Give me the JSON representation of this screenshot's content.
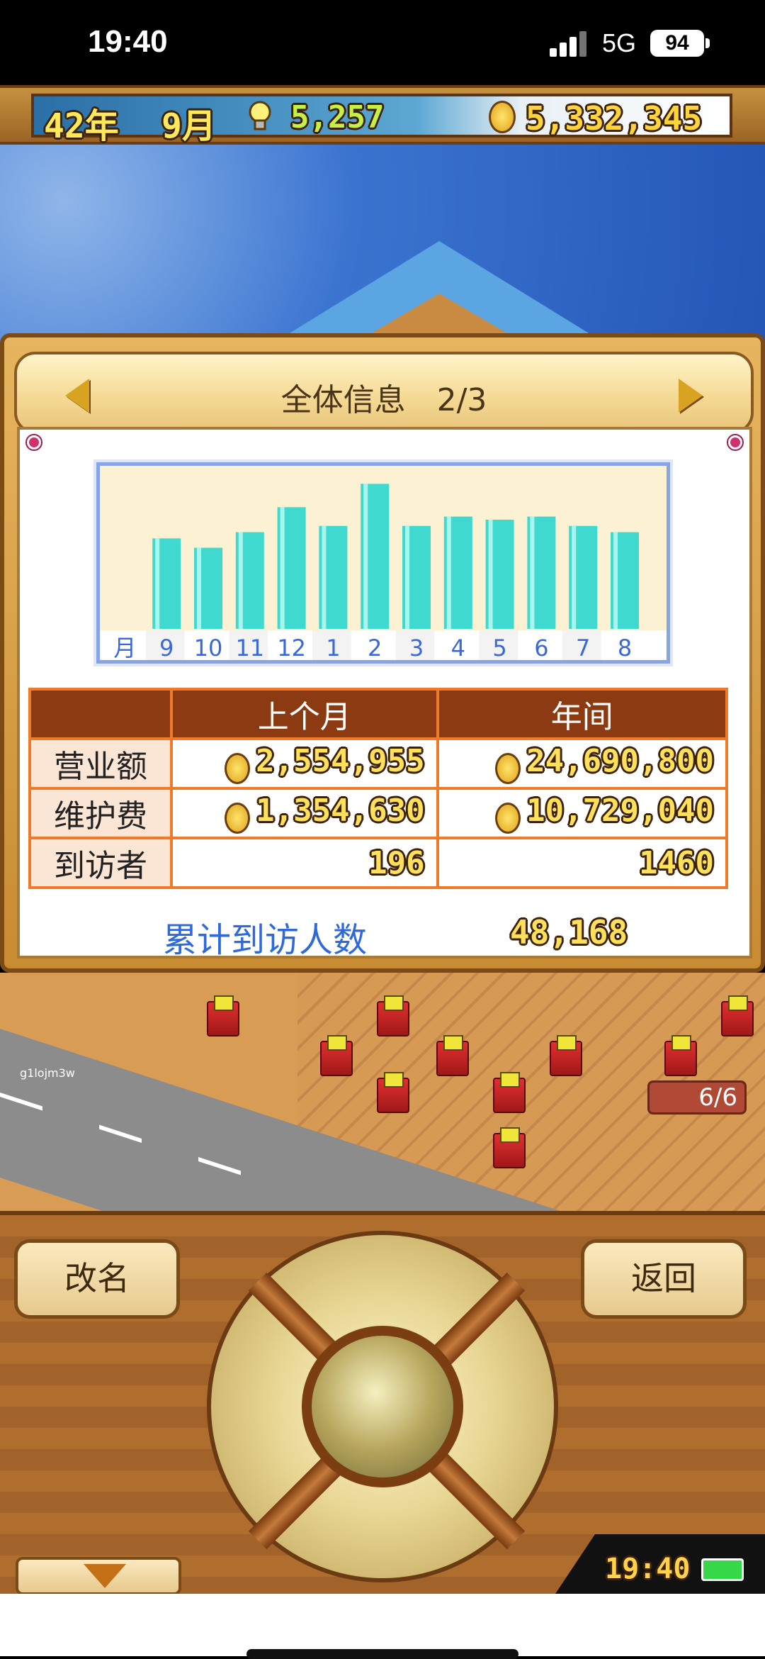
{
  "status_bar": {
    "time": "19:40",
    "network": "5G",
    "battery": "94"
  },
  "hud": {
    "year": "42年",
    "month": "9月",
    "ideas": "5,257",
    "money": "5,332,345"
  },
  "panel": {
    "title": "全体信息　2/3"
  },
  "chart_data": {
    "type": "bar",
    "categories": [
      "9",
      "10",
      "11",
      "12",
      "1",
      "2",
      "3",
      "4",
      "5",
      "6",
      "7",
      "8"
    ],
    "values": [
      58,
      52,
      62,
      78,
      66,
      93,
      66,
      72,
      70,
      72,
      66,
      62
    ],
    "axis_prefix": "月",
    "ylim": [
      0,
      100
    ],
    "grid": false,
    "colors": {
      "bar": "#3fd9d0",
      "bar_highlight": "#a8f5ef",
      "background": "#fdf1d4",
      "label": "#3a68d6"
    }
  },
  "table": {
    "headers": [
      "上个月",
      "年间"
    ],
    "rows": [
      {
        "label": "营业额",
        "last_month": "2,554,955",
        "yearly": "24,690,800",
        "coin": true
      },
      {
        "label": "维护费",
        "last_month": "1,354,630",
        "yearly": "10,729,040",
        "coin": true
      },
      {
        "label": "到访者",
        "last_month": "196",
        "yearly": "1460",
        "coin": false
      }
    ]
  },
  "cumulative": {
    "label": "累计到访人数",
    "value": "48,168"
  },
  "world": {
    "capacity": "6/6",
    "player_tag": "g1lojm3w"
  },
  "controls": {
    "rename_label": "改名",
    "back_label": "返回",
    "clock": "19:40"
  },
  "colors": {
    "accent_brown": "#8b3a12",
    "table_border": "#ee7a2a",
    "link_blue": "#2f6ad8",
    "gold": "#ffe05a"
  }
}
